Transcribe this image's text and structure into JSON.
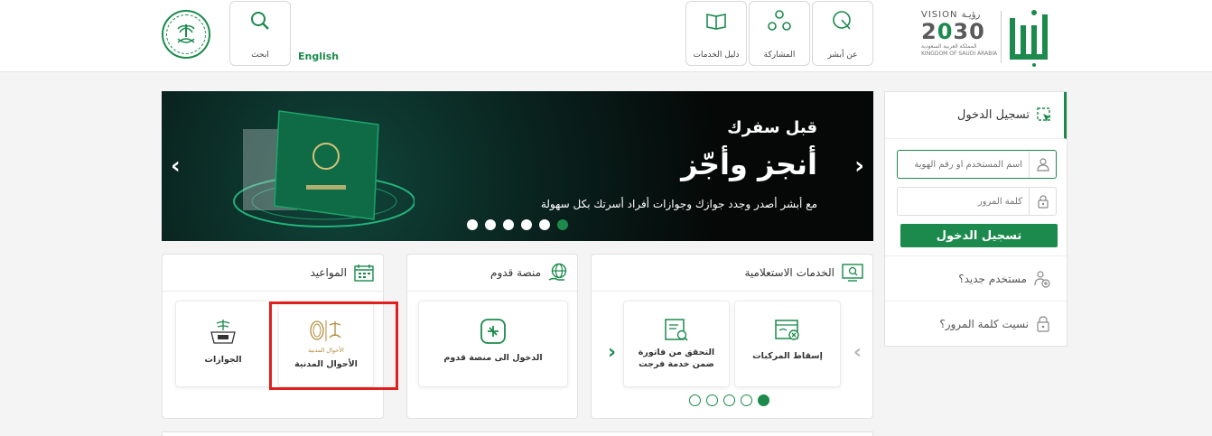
{
  "header": {
    "search_label": "ابحث",
    "english_label": "English",
    "nav": [
      {
        "label": "دليل الخدمات",
        "icon": "book-icon"
      },
      {
        "label": "المشاركة",
        "icon": "share-network-icon"
      },
      {
        "label": "عن أبشر",
        "icon": "about-pointer-icon"
      }
    ],
    "vision": {
      "top": "VISION رؤيـة",
      "number_a": "2",
      "number_b": "0",
      "number_c": "30",
      "sub_ar": "المملكة العربية السعودية",
      "sub_en": "KINGDOM OF SAUDI ARABIA"
    },
    "logo_text": "أبشر"
  },
  "slider": {
    "title": "قبل سفرك",
    "headline": "أنجز وأجّز",
    "description": "مع أبشر أصدر وجدد جوازك وجوازات أفراد أسرتك بكل سهولة",
    "prev": "‹",
    "next": "›",
    "dot_count": 6,
    "active_dot": 5
  },
  "cards": {
    "appointments": {
      "title": "المواعيد",
      "tiles": [
        {
          "label": "الأحوال المدنية",
          "logo_text": "الأحوال المدنية"
        },
        {
          "label": "الجوازات"
        }
      ]
    },
    "qudoom": {
      "title": "منصة قدوم",
      "tiles": [
        {
          "label": "الدخول الى منصة قدوم"
        }
      ]
    },
    "inquiry": {
      "title": "الخدمات الاستعلامية",
      "tiles": [
        {
          "label": "إسقاط المركبات"
        },
        {
          "label": "التحقق من فاتورة ضمن خدمة فرجت"
        }
      ],
      "prev": "‹",
      "next": "›",
      "dot_count": 5,
      "active_dot": 4
    }
  },
  "login": {
    "title": "تسجيل الدخول",
    "username_placeholder": "اسم المستخدم أو رقم الهوية",
    "password_placeholder": "كلمة المرور",
    "submit": "تسجيل الدخول",
    "new_user": "مستخدم جديد؟",
    "forgot_password": "نسيت كلمة المرور؟"
  },
  "colors": {
    "brand_green": "#1b8a4c",
    "highlight_red": "#e0201e"
  }
}
